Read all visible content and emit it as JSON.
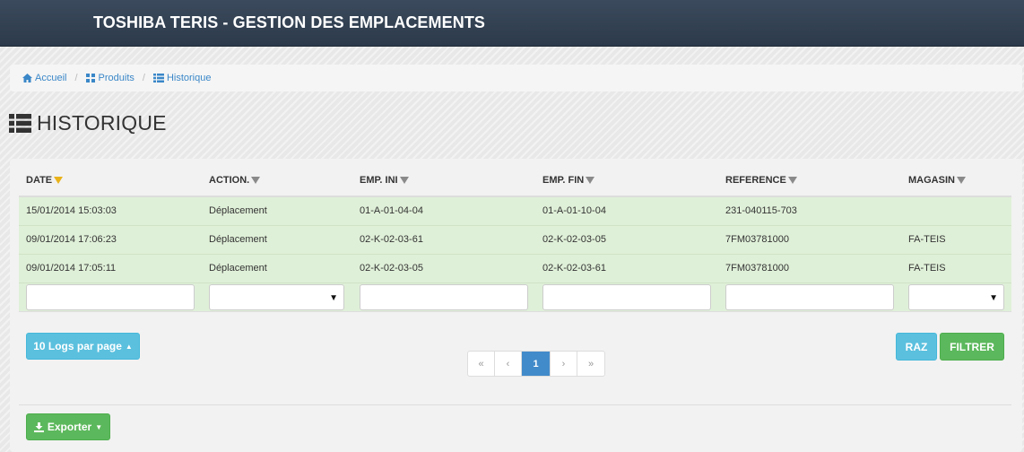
{
  "app": {
    "title": "TOSHIBA TERIS - GESTION DES EMPLACEMENTS"
  },
  "breadcrumb": [
    {
      "label": "Accueil",
      "icon": "home-icon"
    },
    {
      "label": "Produits",
      "icon": "sitemap-icon"
    },
    {
      "label": "Historique",
      "icon": "list-icon"
    }
  ],
  "page": {
    "title": "HISTORIQUE",
    "icon": "list-icon"
  },
  "table": {
    "columns": [
      "DATE",
      "ACTION.",
      "EMP. INI",
      "EMP. FIN",
      "REFERENCE",
      "MAGASIN"
    ],
    "active_sort_color": "#e8b21a",
    "rows": [
      [
        "15/01/2014 15:03:03",
        "Déplacement",
        "01-A-01-04-04",
        "01-A-01-10-04",
        "231-040115-703",
        ""
      ],
      [
        "09/01/2014 17:06:23",
        "Déplacement",
        "02-K-02-03-61",
        "02-K-02-03-05",
        "7FM03781000",
        "FA-TEIS"
      ],
      [
        "09/01/2014 17:05:11",
        "Déplacement",
        "02-K-02-03-05",
        "02-K-02-03-61",
        "7FM03781000",
        "FA-TEIS"
      ]
    ],
    "row_color": "#dff0d8"
  },
  "filters": {
    "date": "",
    "action": "",
    "emp_ini": "",
    "emp_fin": "",
    "reference": "",
    "magasin": ""
  },
  "controls": {
    "logs_per_page": "10 Logs par page",
    "raz": "RAZ",
    "filtrer": "FILTRER",
    "export": "Exporter"
  },
  "pagination": {
    "first": "«",
    "prev": "‹",
    "current": "1",
    "next": "›",
    "last": "»"
  },
  "colors": {
    "topbar": "#2c3a4b",
    "link": "#3a87c8",
    "info": "#5bc0de",
    "success": "#5cb85c",
    "primary": "#428bca"
  }
}
